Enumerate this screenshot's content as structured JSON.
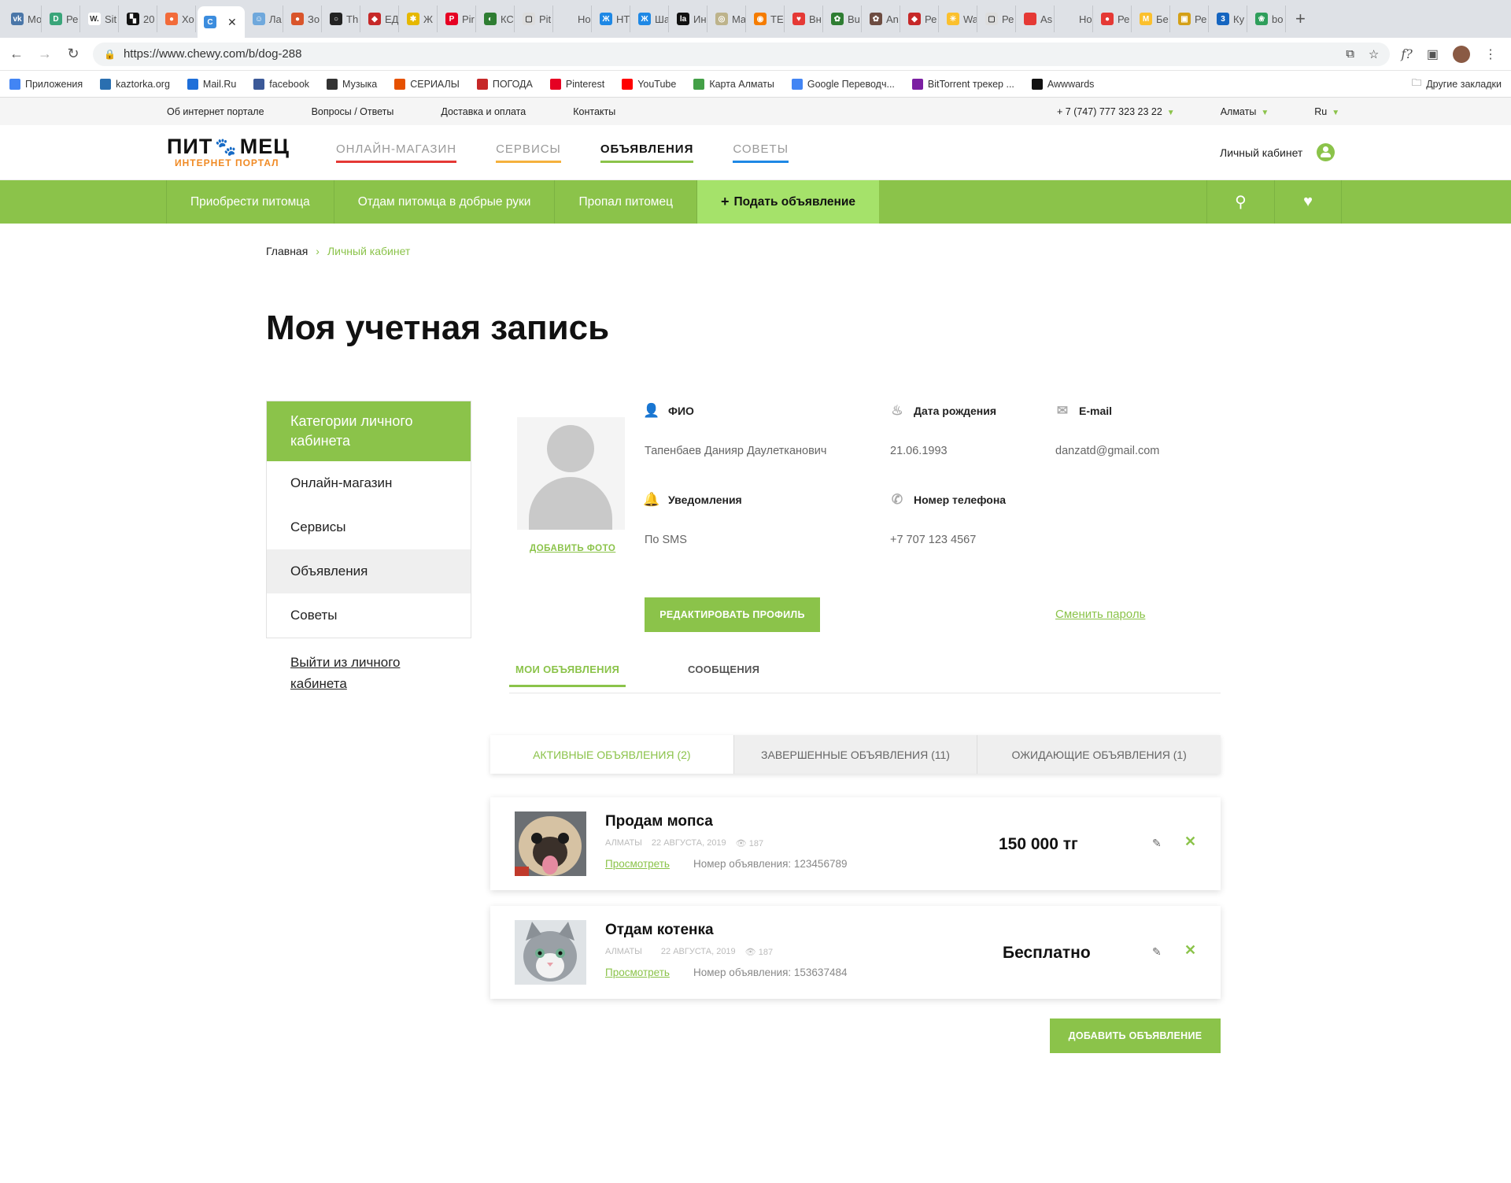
{
  "browser": {
    "tabs": [
      {
        "label": "Мо",
        "color": "#4a76a8",
        "glyph": "vk"
      },
      {
        "label": "Ре",
        "color": "#3aa57a",
        "glyph": "D"
      },
      {
        "label": "Sit",
        "color": "#ffffff",
        "glyph": "W."
      },
      {
        "label": "20",
        "color": "#111111",
        "glyph": "▚"
      },
      {
        "label": "Хо",
        "color": "#f26b3a",
        "glyph": "●"
      },
      {
        "label": "",
        "color": "#3c8dde",
        "glyph": "C"
      },
      {
        "label": "Ла",
        "color": "#6fa8dc",
        "glyph": "☺"
      },
      {
        "label": "Зо",
        "color": "#d9552b",
        "glyph": "●"
      },
      {
        "label": "Th",
        "color": "#222222",
        "glyph": "○"
      },
      {
        "label": "ЕД",
        "color": "#c62828",
        "glyph": "◆"
      },
      {
        "label": "Ж",
        "color": "#e6b800",
        "glyph": "✱"
      },
      {
        "label": "Pir",
        "color": "#e60023",
        "glyph": "P"
      },
      {
        "label": "КС",
        "color": "#2e7d32",
        "glyph": "◐"
      },
      {
        "label": "Pit",
        "color": "#dddddd",
        "glyph": "▢"
      },
      {
        "label": "Новая",
        "color": "#dee1e6",
        "glyph": ""
      },
      {
        "label": "НТ",
        "color": "#1e88e5",
        "glyph": "Ж"
      },
      {
        "label": "Ша",
        "color": "#1e88e5",
        "glyph": "Ж"
      },
      {
        "label": "Ин",
        "color": "#111111",
        "glyph": "la"
      },
      {
        "label": "Ma",
        "color": "#bdb38b",
        "glyph": "◎"
      },
      {
        "label": "ТЕ",
        "color": "#f57c00",
        "glyph": "◉"
      },
      {
        "label": "Вн",
        "color": "#e53935",
        "glyph": "♥"
      },
      {
        "label": "Bu",
        "color": "#2e7d32",
        "glyph": "✿"
      },
      {
        "label": "An",
        "color": "#6d4c41",
        "glyph": "✿"
      },
      {
        "label": "Ре",
        "color": "#c62828",
        "glyph": "◆"
      },
      {
        "label": "Wa",
        "color": "#fbc02d",
        "glyph": "✳"
      },
      {
        "label": "Ре",
        "color": "#dddddd",
        "glyph": "▢"
      },
      {
        "label": "As",
        "color": "#e53935",
        "glyph": ""
      },
      {
        "label": "Новая",
        "color": "#dee1e6",
        "glyph": ""
      },
      {
        "label": "Ре",
        "color": "#e53935",
        "glyph": "●"
      },
      {
        "label": "Бе",
        "color": "#fbc02d",
        "glyph": "M"
      },
      {
        "label": "Ре",
        "color": "#d4a017",
        "glyph": "▣"
      },
      {
        "label": "Ку",
        "color": "#1565c0",
        "glyph": "3"
      },
      {
        "label": "bo",
        "color": "#2e9e5b",
        "glyph": "❀"
      }
    ],
    "url": "https://www.chewy.com/b/dog-288",
    "bookmarks": [
      {
        "label": "Приложения",
        "color": "#4285f4"
      },
      {
        "label": "kaztorka.org",
        "color": "#2a6fb0"
      },
      {
        "label": "Mail.Ru",
        "color": "#1e6fd9"
      },
      {
        "label": "facebook",
        "color": "#3b5998"
      },
      {
        "label": "Музыка",
        "color": "#333333"
      },
      {
        "label": "СЕРИАЛЫ",
        "color": "#e65100"
      },
      {
        "label": "ПОГОДА",
        "color": "#c62828"
      },
      {
        "label": "Pinterest",
        "color": "#e60023"
      },
      {
        "label": "YouTube",
        "color": "#ff0000"
      },
      {
        "label": "Карта Алматы",
        "color": "#43a047"
      },
      {
        "label": "Google Переводч...",
        "color": "#4285f4"
      },
      {
        "label": "BitTorrent трекер ...",
        "color": "#7b1fa2"
      },
      {
        "label": "Awwwards",
        "color": "#111111"
      }
    ],
    "other_bookmarks": "Другие закладки"
  },
  "site": {
    "top_links": [
      "Об интернет портале",
      "Вопросы / Ответы",
      "Доставка и оплата",
      "Контакты"
    ],
    "phone": "+ 7 (747) 777 323 23 22",
    "city": "Алматы",
    "lang": "Ru",
    "logo_main_1": "ПИТ",
    "logo_main_2": "МЕЦ",
    "logo_sub": "ИНТЕРНЕТ ПОРТАЛ",
    "main_nav": [
      {
        "label": "ОНЛАЙН-МАГАЗИН",
        "underline": "#e53935",
        "active": false
      },
      {
        "label": "СЕРВИСЫ",
        "underline": "#f5b13d",
        "active": false
      },
      {
        "label": "ОБЪЯВЛЕНИЯ",
        "underline": "#8bc34a",
        "active": true
      },
      {
        "label": "СОВЕТЫ",
        "underline": "#1e88e5",
        "active": false
      }
    ],
    "account_label": "Личный кабинет",
    "green_nav": [
      "Приобрести питомца",
      "Отдам питомца в добрые руки",
      "Пропал питомец"
    ],
    "add_ad_label": "Подать объявление"
  },
  "page": {
    "breadcrumb_home": "Главная",
    "breadcrumb_current": "Личный кабинет",
    "title": "Моя учетная запись",
    "sidebar_head": "Категории личного кабинета",
    "sidebar_items": [
      "Онлайн-магазин",
      "Сервисы",
      "Объявления",
      "Советы"
    ],
    "logout": "Выйти из личного кабинета",
    "add_photo": "ДОБАВИТЬ ФОТО",
    "profile": {
      "fio_label": "ФИО",
      "fio": "Тапенбаев Данияр Даулетканович",
      "birth_label": "Дата рождения",
      "birth": "21.06.1993",
      "email_label": "E-mail",
      "email": "danzatd@gmail.com",
      "notify_label": "Уведомления",
      "notify": "По SMS",
      "phone_label": "Номер телефона",
      "phone": "+7 707 123 4567"
    },
    "edit_profile": "РЕДАКТИРОВАТЬ ПРОФИЛЬ",
    "change_password": "Сменить пароль",
    "tab_my_ads": "МОИ ОБЪЯВЛЕНИЯ",
    "tab_messages": "СООБЩЕНИЯ",
    "subtabs": [
      "АКТИВНЫЕ ОБЪЯВЛЕНИЯ (2)",
      "ЗАВЕРШЕННЫЕ ОБЪЯВЛЕНИЯ (11)",
      "ОЖИДАЮЩИЕ ОБЪЯВЛЕНИЯ (1)"
    ],
    "ads": [
      {
        "title": "Продам мопса",
        "city": "АЛМАТЫ",
        "date": "22 АВГУСТА, 2019",
        "views": "187",
        "view_link": "Просмотреть",
        "number": "Номер объявления: 123456789",
        "price": "150 000 тг"
      },
      {
        "title": "Отдам котенка",
        "city": "АЛМАТЫ",
        "date": "22 АВГУСТА, 2019",
        "views": "187",
        "view_link": "Просмотреть",
        "number": "Номер объявления: 153637484",
        "price": "Бесплатно"
      }
    ],
    "add_ad_button": "ДОБАВИТЬ ОБЪЯВЛЕНИЕ"
  },
  "colors": {
    "accent": "#8bc34a",
    "orange": "#f08a24"
  }
}
